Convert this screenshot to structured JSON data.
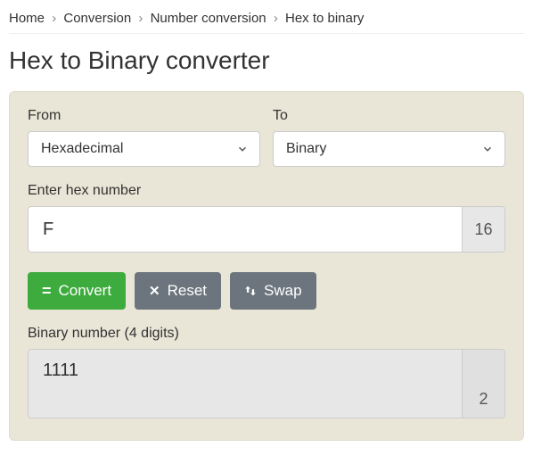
{
  "breadcrumb": {
    "items": [
      "Home",
      "Conversion",
      "Number conversion",
      "Hex to binary"
    ],
    "sep": "›"
  },
  "title": "Hex to Binary converter",
  "from": {
    "label": "From",
    "value": "Hexadecimal"
  },
  "to": {
    "label": "To",
    "value": "Binary"
  },
  "input": {
    "label": "Enter hex number",
    "value": "F",
    "base": "16"
  },
  "buttons": {
    "convert": "Convert",
    "reset": "Reset",
    "swap": "Swap"
  },
  "output": {
    "label": "Binary number (4 digits)",
    "value": "1111",
    "base": "2"
  }
}
